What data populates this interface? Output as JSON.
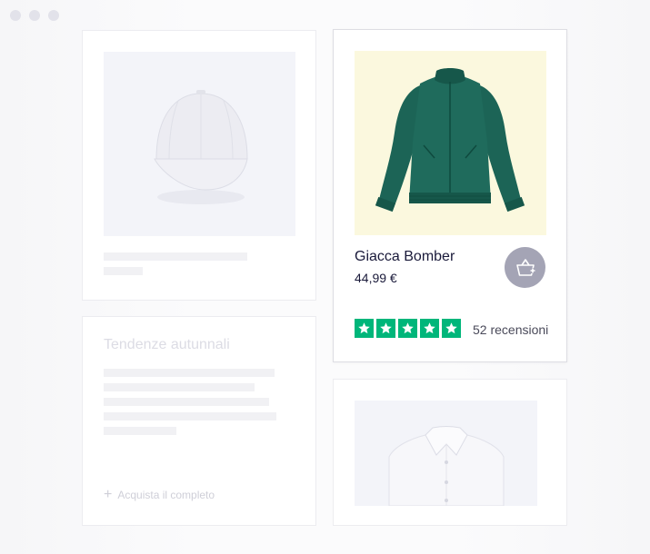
{
  "window": {
    "controls": [
      "close",
      "minimize",
      "maximize"
    ]
  },
  "cap_card": {
    "image_icon": "cap-image"
  },
  "trends_card": {
    "title": "Tendenze autunnali",
    "link_label": "Acquista il completo",
    "link_icon": "plus-icon"
  },
  "product_card": {
    "image_icon": "bomber-jacket-image",
    "name": "Giacca Bomber",
    "price": "44,99 €",
    "cart_icon": "basket-add-icon",
    "rating": 5,
    "rating_max": 5,
    "reviews": "52 recensioni",
    "colors": {
      "image_bg": "#fbf8de",
      "jacket": "#1f6b5c",
      "star_bg": "#00b67a",
      "button_bg": "#a4a4b5"
    }
  },
  "polo_card": {
    "image_icon": "polo-shirt-image"
  }
}
